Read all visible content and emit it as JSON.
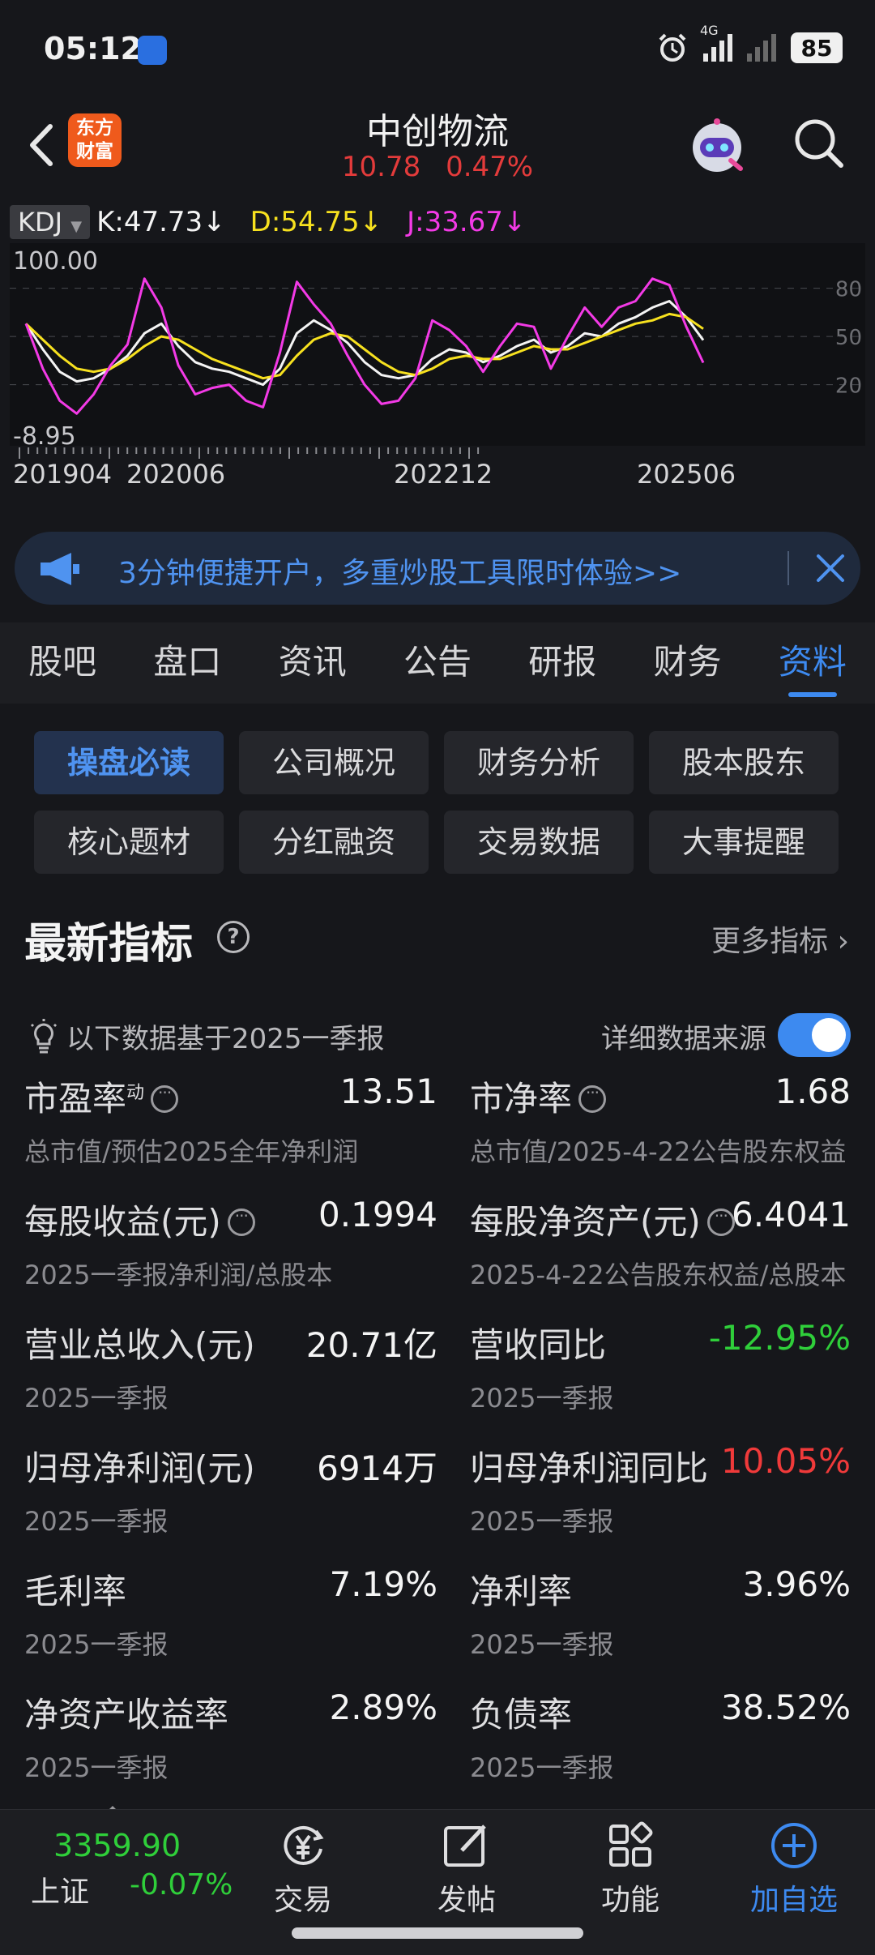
{
  "status_bar": {
    "time": "05:12",
    "battery": "85",
    "network": "4G"
  },
  "header": {
    "stock_name": "中创物流",
    "price": "10.78",
    "change_pct": "0.47%",
    "logo_text_1": "东方",
    "logo_text_2": "财富"
  },
  "kdj": {
    "selector": "KDJ",
    "k_label": "K:47.73↓",
    "d_label": "D:54.75↓",
    "j_label": "J:33.67↓",
    "max_label": "100.00",
    "min_label": "-8.95",
    "right_ticks": [
      "80",
      "50",
      "20"
    ],
    "date_ticks": [
      "201904",
      "202006",
      "202212",
      "202506"
    ]
  },
  "chart_data": {
    "type": "line",
    "title": "KDJ",
    "ylim": [
      -8.95,
      100
    ],
    "x_tick_labels": [
      "201904",
      "202006",
      "202212",
      "202506"
    ],
    "series": [
      {
        "name": "K",
        "color": "#f4f4f4",
        "values": [
          58,
          42,
          28,
          22,
          24,
          30,
          38,
          52,
          58,
          44,
          34,
          30,
          28,
          24,
          20,
          30,
          52,
          60,
          54,
          46,
          34,
          26,
          24,
          26,
          36,
          42,
          40,
          34,
          38,
          44,
          48,
          40,
          44,
          52,
          50,
          58,
          62,
          68,
          72,
          62,
          47.73
        ]
      },
      {
        "name": "D",
        "color": "#f7e11f",
        "values": [
          58,
          48,
          38,
          30,
          28,
          30,
          36,
          44,
          50,
          48,
          42,
          36,
          32,
          28,
          24,
          26,
          38,
          48,
          52,
          50,
          42,
          34,
          28,
          26,
          30,
          36,
          38,
          36,
          36,
          40,
          44,
          42,
          42,
          46,
          50,
          54,
          58,
          60,
          64,
          62,
          54.75
        ]
      },
      {
        "name": "J",
        "color": "#f33ae6",
        "values": [
          58,
          30,
          10,
          2,
          14,
          32,
          45,
          86,
          68,
          32,
          14,
          18,
          20,
          10,
          6,
          40,
          84,
          70,
          58,
          38,
          20,
          8,
          10,
          24,
          60,
          54,
          44,
          28,
          44,
          58,
          56,
          30,
          50,
          68,
          56,
          68,
          72,
          86,
          82,
          56,
          33.67
        ]
      }
    ]
  },
  "banner": {
    "text": "3分钟便捷开户，多重炒股工具限时体验>>"
  },
  "tabs": [
    "股吧",
    "盘口",
    "资讯",
    "公告",
    "研报",
    "财务",
    "资料"
  ],
  "active_tab": "资料",
  "sub_buttons": [
    "操盘必读",
    "公司概况",
    "财务分析",
    "股本股东",
    "核心题材",
    "分红融资",
    "交易数据",
    "大事提醒"
  ],
  "section": {
    "title": "最新指标",
    "help": "?",
    "more": "更多指标 ›",
    "note": "以下数据基于2025一季报",
    "source_label": "详细数据来源",
    "source_toggle_on": true
  },
  "metrics": [
    {
      "label": "市盈率",
      "sup": "动",
      "info": true,
      "value": "13.51",
      "desc": "总市值/预估2025全年净利润"
    },
    {
      "label": "市净率",
      "sup": "",
      "info": true,
      "value": "1.68",
      "desc": "总市值/2025-4-22公告股东权益"
    },
    {
      "label": "每股收益(元)",
      "sup": "",
      "info": true,
      "value": "0.1994",
      "desc": "2025一季报净利润/总股本"
    },
    {
      "label": "每股净资产(元)",
      "sup": "",
      "info": true,
      "value": "6.4041",
      "desc": "2025-4-22公告股东权益/总股本"
    },
    {
      "label": "营业总收入(元)",
      "sup": "",
      "info": false,
      "value": "20.71亿",
      "desc": "2025一季报"
    },
    {
      "label": "营收同比",
      "sup": "",
      "info": false,
      "value": "-12.95%",
      "desc": "2025一季报",
      "tone": "down"
    },
    {
      "label": "归母净利润(元)",
      "sup": "",
      "info": false,
      "value": "6914万",
      "desc": "2025一季报"
    },
    {
      "label": "归母净利润同比",
      "sup": "",
      "info": false,
      "value": "10.05%",
      "desc": "2025一季报",
      "tone": "up"
    },
    {
      "label": "毛利率",
      "sup": "",
      "info": false,
      "value": "7.19%",
      "desc": "2025一季报"
    },
    {
      "label": "净利率",
      "sup": "",
      "info": false,
      "value": "3.96%",
      "desc": "2025一季报"
    },
    {
      "label": "净资产收益率",
      "sup": "",
      "info": false,
      "value": "2.89%",
      "desc": "2025一季报"
    },
    {
      "label": "负债率",
      "sup": "",
      "info": false,
      "value": "38.52%",
      "desc": "2025一季报"
    }
  ],
  "bottom_nav": {
    "index_price": "3359.90",
    "index_name": "上证",
    "index_change": "-0.07%",
    "items": [
      {
        "label": "交易",
        "icon": "yen-trade-icon"
      },
      {
        "label": "发帖",
        "icon": "edit-post-icon"
      },
      {
        "label": "功能",
        "icon": "grid-apps-icon"
      },
      {
        "label": "加自选",
        "icon": "add-circle-icon"
      }
    ]
  }
}
